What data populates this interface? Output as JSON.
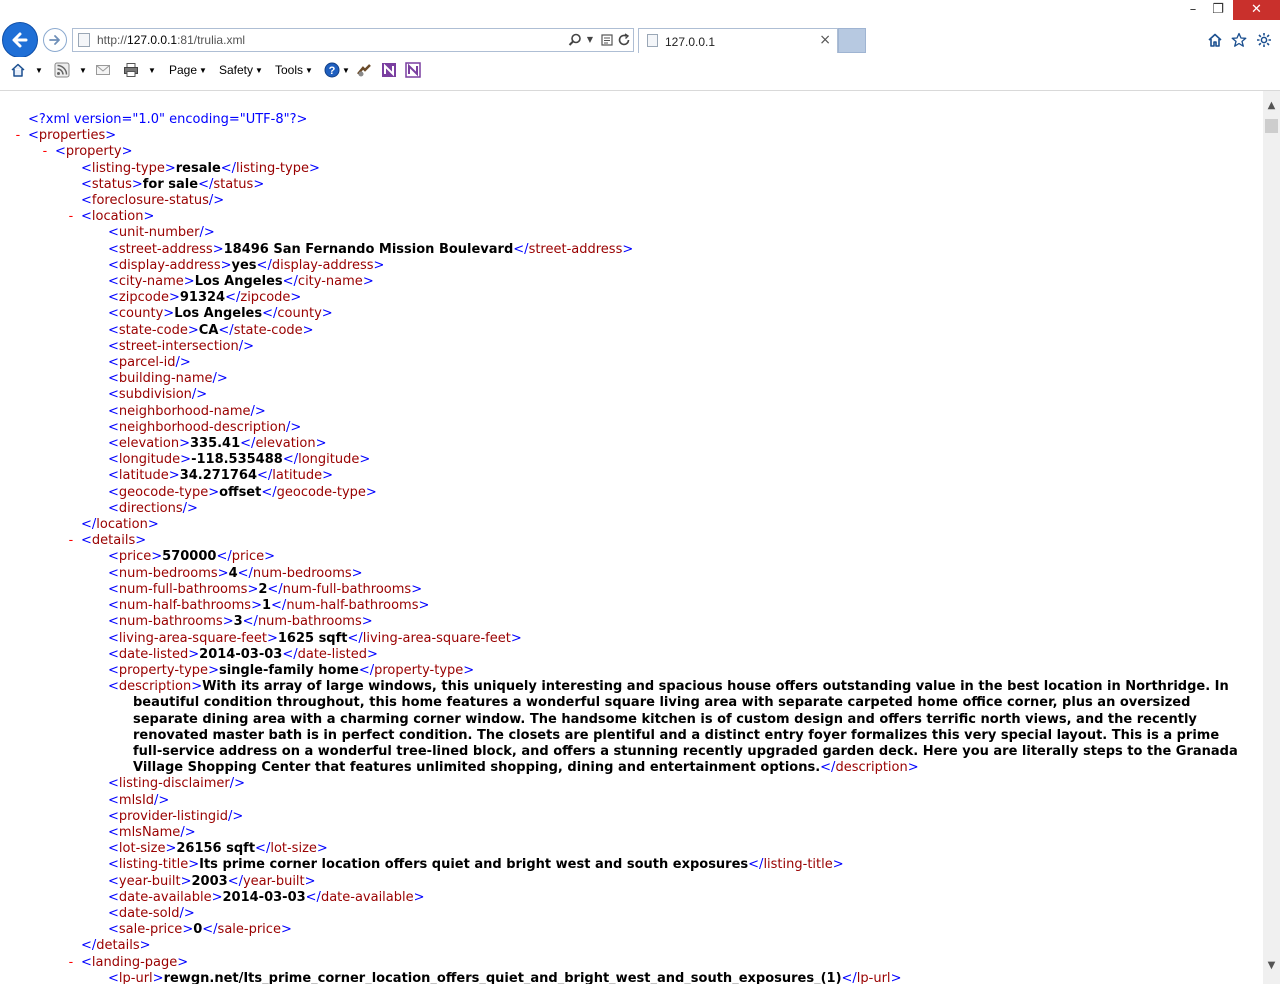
{
  "browser": {
    "address_url_prefix": "http://",
    "address_url_host": "127.0.0.1",
    "address_url_rest": ":81/trulia.xml",
    "tab_title": "127.0.0.1",
    "tab_close": "×",
    "window_controls": {
      "minimize": "–",
      "restore": "❐",
      "close": "✕"
    },
    "icons": {
      "back": "arrow-left-icon",
      "forward": "arrow-right-icon",
      "search": "search-icon",
      "compat": "compatibility-view-icon",
      "refresh": "refresh-icon",
      "home": "home-icon",
      "favorites": "star-icon",
      "settings": "gear-icon"
    },
    "accent_color": "#1f6fd6"
  },
  "command_bar": {
    "page": "Page",
    "safety": "Safety",
    "tools": "Tools",
    "help_symbol": "?"
  },
  "xml": {
    "declaration": "<?xml version=\"1.0\" encoding=\"UTF-8\"?>",
    "toggle": "-",
    "root": "properties",
    "property": "property",
    "lines": [
      {
        "indent": 2,
        "tag": "listing-type",
        "value": "resale"
      },
      {
        "indent": 2,
        "tag": "status",
        "value": "for sale"
      },
      {
        "indent": 2,
        "tag": "foreclosure-status",
        "empty": true
      },
      {
        "indent": 2,
        "tag": "location",
        "open": true
      },
      {
        "indent": 3,
        "tag": "unit-number",
        "empty": true
      },
      {
        "indent": 3,
        "tag": "street-address",
        "value": "18496 San Fernando Mission Boulevard"
      },
      {
        "indent": 3,
        "tag": "display-address",
        "value": "yes"
      },
      {
        "indent": 3,
        "tag": "city-name",
        "value": "Los Angeles"
      },
      {
        "indent": 3,
        "tag": "zipcode",
        "value": "91324"
      },
      {
        "indent": 3,
        "tag": "county",
        "value": "Los Angeles"
      },
      {
        "indent": 3,
        "tag": "state-code",
        "value": "CA"
      },
      {
        "indent": 3,
        "tag": "street-intersection",
        "empty": true
      },
      {
        "indent": 3,
        "tag": "parcel-id",
        "empty": true
      },
      {
        "indent": 3,
        "tag": "building-name",
        "empty": true
      },
      {
        "indent": 3,
        "tag": "subdivision",
        "empty": true
      },
      {
        "indent": 3,
        "tag": "neighborhood-name",
        "empty": true
      },
      {
        "indent": 3,
        "tag": "neighborhood-description",
        "empty": true
      },
      {
        "indent": 3,
        "tag": "elevation",
        "value": "335.41"
      },
      {
        "indent": 3,
        "tag": "longitude",
        "value": "-118.535488"
      },
      {
        "indent": 3,
        "tag": "latitude",
        "value": "34.271764"
      },
      {
        "indent": 3,
        "tag": "geocode-type",
        "value": "offset"
      },
      {
        "indent": 3,
        "tag": "directions",
        "empty": true
      },
      {
        "indent": 2,
        "tag": "location",
        "close": true
      },
      {
        "indent": 2,
        "tag": "details",
        "open": true
      },
      {
        "indent": 3,
        "tag": "price",
        "value": "570000"
      },
      {
        "indent": 3,
        "tag": "num-bedrooms",
        "value": "4"
      },
      {
        "indent": 3,
        "tag": "num-full-bathrooms",
        "value": "2"
      },
      {
        "indent": 3,
        "tag": "num-half-bathrooms",
        "value": "1"
      },
      {
        "indent": 3,
        "tag": "num-bathrooms",
        "value": "3"
      },
      {
        "indent": 3,
        "tag": "living-area-square-feet",
        "value": "1625 sqft"
      },
      {
        "indent": 3,
        "tag": "date-listed",
        "value": "2014-03-03"
      },
      {
        "indent": 3,
        "tag": "property-type",
        "value": "single-family home"
      },
      {
        "indent": 3,
        "tag": "description",
        "value": "With its array of large windows, this uniquely interesting and spacious house offers outstanding value in the best location in Northridge. In beautiful condition throughout, this home features a wonderful square living area with separate carpeted home office corner, plus an oversized separate dining area with a charming corner window. The handsome kitchen is of custom design and offers terrific north views, and the recently renovated master bath is in perfect condition. The closets are plentiful and a distinct entry foyer formalizes this very special layout. This is a prime full-service address on a wonderful tree-lined block, and offers a stunning recently upgraded garden deck. Here you are literally steps to the Granada Village Shopping Center that features unlimited shopping, dining and entertainment options.",
        "multiline": true
      },
      {
        "indent": 3,
        "tag": "listing-disclaimer",
        "empty": true
      },
      {
        "indent": 3,
        "tag": "mlsId",
        "empty": true
      },
      {
        "indent": 3,
        "tag": "provider-listingid",
        "empty": true
      },
      {
        "indent": 3,
        "tag": "mlsName",
        "empty": true
      },
      {
        "indent": 3,
        "tag": "lot-size",
        "value": "26156 sqft"
      },
      {
        "indent": 3,
        "tag": "listing-title",
        "value": "Its prime corner location offers quiet and bright west and south exposures"
      },
      {
        "indent": 3,
        "tag": "year-built",
        "value": "2003"
      },
      {
        "indent": 3,
        "tag": "date-available",
        "value": "2014-03-03"
      },
      {
        "indent": 3,
        "tag": "date-sold",
        "empty": true
      },
      {
        "indent": 3,
        "tag": "sale-price",
        "value": "0"
      },
      {
        "indent": 2,
        "tag": "details",
        "close": true
      },
      {
        "indent": 2,
        "tag": "landing-page",
        "open": true
      },
      {
        "indent": 3,
        "tag": "lp-url",
        "value": "rewgn.net/Its_prime_corner_location_offers_quiet_and_bright_west_and_south_exposures_(1)"
      }
    ]
  },
  "colors": {
    "tag": "#990000",
    "bracket": "#0000ff",
    "toggle": "#ff0000",
    "value": "#000000"
  }
}
